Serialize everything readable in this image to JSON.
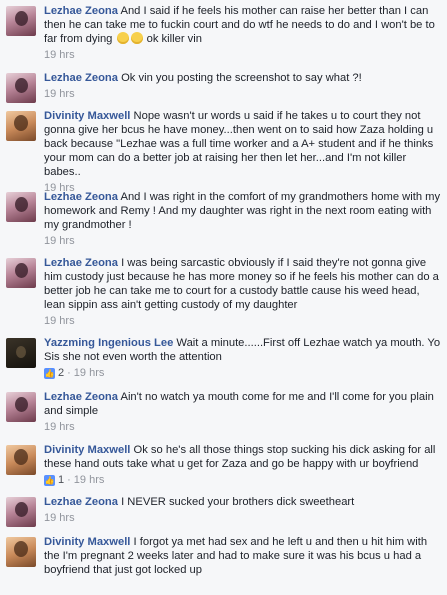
{
  "comments": [
    {
      "author": "Lezhae Zeona",
      "text": "And I said if he feels his mother can raise her better than I can then he can take me to fuckin court and do wtf he needs to do and I won't be to far from dying",
      "text_tail": "ok killer vin",
      "time": "19 hrs"
    },
    {
      "author": "Lezhae Zeona",
      "text": "Ok vin you posting the screenshot to say what ?!",
      "time": "19 hrs"
    },
    {
      "author": "Divinity Maxwell",
      "text": "Nope wasn't ur words u said if he takes u to court they not gonna give her bcus he have money...then went on to said how Zaza holding u back because \"Lezhae was a full time worker and a A+ student and if he thinks your mom can do a better job at raising her then let her...and I'm not killer babes..",
      "time": "19 hrs"
    },
    {
      "author": "Lezhae Zeona",
      "text": "And I was right in the comfort of my grandmothers home with my homework and Remy ! And my daughter was right in the next room eating with my grandmother !",
      "time": "19 hrs"
    },
    {
      "author": "Lezhae Zeona",
      "text": "I was being sarcastic obviously if I said they're not gonna give him custody just because he has more money so if he feels his mother can do a better job he can take me to court for a custody battle cause his weed head, lean sippin ass ain't getting custody of my daughter",
      "time": "19 hrs"
    },
    {
      "author": "Yazzming Ingenious Lee",
      "text": "Wait a minute......First off Lezhae watch ya mouth. Yo Sis she not even worth the attention",
      "likes": "2",
      "time": "19 hrs"
    },
    {
      "author": "Lezhae Zeona",
      "text": "Ain't no watch ya mouth come for me and I'll come for you plain and simple",
      "time": "19 hrs"
    },
    {
      "author": "Divinity Maxwell",
      "text": "Ok so he's all those things stop sucking his dick asking for all these hand outs take what u get for Zaza and go be happy with ur boyfriend",
      "likes": "1",
      "time": "19 hrs"
    },
    {
      "author": "Lezhae Zeona",
      "text": "I NEVER sucked your brothers dick sweetheart",
      "time": "19 hrs"
    },
    {
      "author": "Divinity Maxwell",
      "text": "I forgot ya met had sex and he left u and then u hit him with the I'm pregnant 2 weeks later and had to make sure it was his bcus u had a boyfriend that just got locked up",
      "time": ""
    }
  ],
  "separator": " · ",
  "icons": {
    "like": "thumbs-up-icon",
    "emoji": "grinning-face-icon"
  },
  "colors": {
    "name": "#365899",
    "meta": "#90949c",
    "like": "#5890ff"
  }
}
